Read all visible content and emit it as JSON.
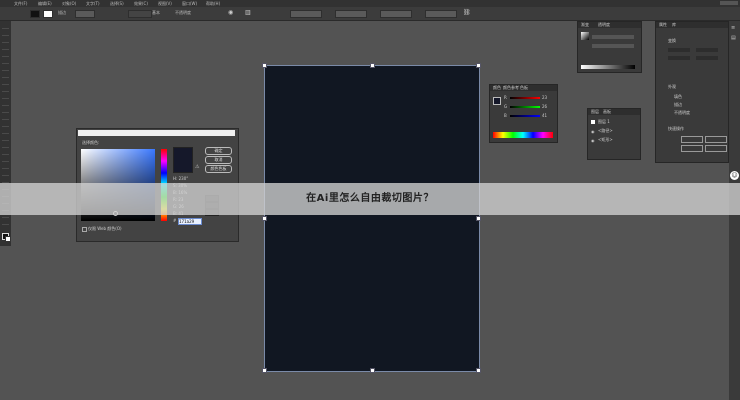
{
  "menu": {
    "items": [
      "文件(F)",
      "编辑(E)",
      "对象(O)",
      "文字(T)",
      "选择(S)",
      "效果(C)",
      "视图(V)",
      "窗口(W)",
      "帮助(H)"
    ]
  },
  "control_bar": {
    "stroke_label": "描边",
    "style_label": "基本",
    "opacity_label": "不透明度"
  },
  "color_picker": {
    "title": "拾色器",
    "select_label": "选择颜色:",
    "ok_label": "确定",
    "cancel_label": "取消",
    "swatches_label": "颜色色板",
    "fields": [
      "H: 230°",
      "S: 30%",
      "B: 16%",
      "R: 23",
      "G: 26",
      "B: 41"
    ],
    "hex_label": "#",
    "hex_value": "171a29",
    "web_only_label": "仅限 Web 颜色(O)",
    "new_color": "#15182a"
  },
  "color_panel": {
    "tabs": [
      "颜色",
      "颜色参考",
      "色板"
    ],
    "channels": [
      "R",
      "G",
      "B"
    ],
    "values": [
      "23",
      "26",
      "41"
    ]
  },
  "gradient_panel": {
    "tabs": [
      "渐变",
      "透明度"
    ]
  },
  "layers_panel": {
    "tabs": [
      "图层",
      "画板"
    ],
    "rows": [
      "图层 1",
      "<路径>",
      "<矩形>"
    ]
  },
  "properties_panel": {
    "tabs": [
      "属性",
      "库"
    ],
    "labels": [
      "变换",
      "外观",
      "填色",
      "描边",
      "不透明度",
      "快速操作"
    ]
  },
  "banner": {
    "text": "在Ai里怎么自由裁切图片？"
  },
  "artboard": {
    "fill": "#111722"
  }
}
